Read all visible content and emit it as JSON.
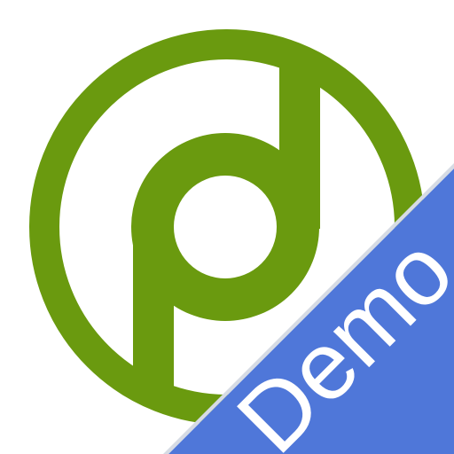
{
  "app_icon": {
    "logo_color": "#6a9a0f",
    "logo_icon": "circled-p-d-logo-icon",
    "ribbon": {
      "label": "Demo",
      "color": "#4f77d9"
    }
  }
}
